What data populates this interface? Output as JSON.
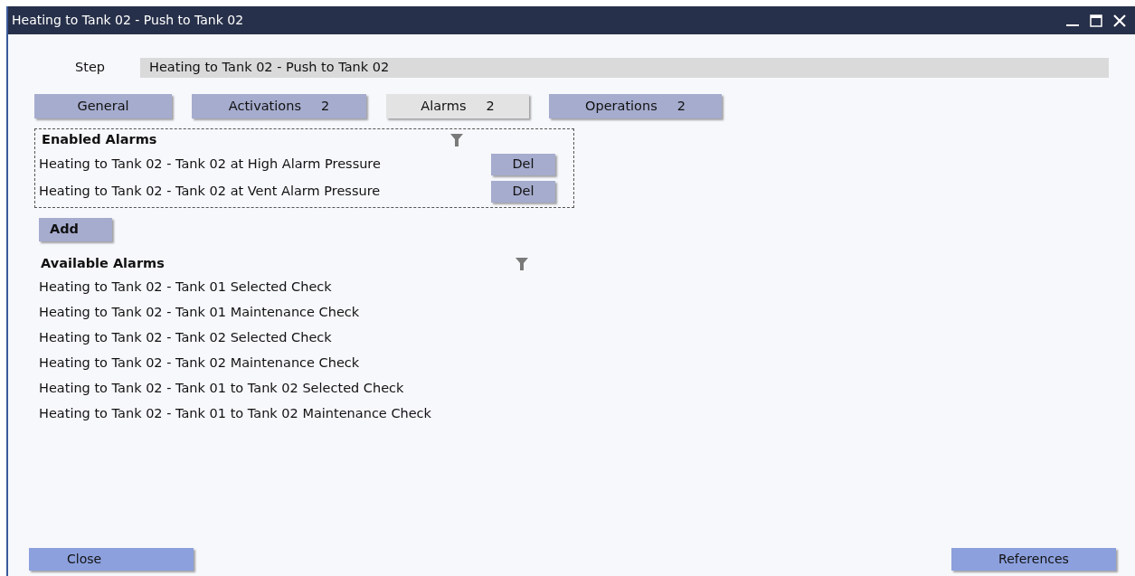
{
  "window": {
    "title": "Heating to Tank 02 - Push to Tank 02"
  },
  "step": {
    "label": "Step",
    "value": "Heating to Tank 02 - Push to Tank 02"
  },
  "tabs": [
    {
      "label": "General",
      "selected": false
    },
    {
      "label": "Activations",
      "count": "2",
      "selected": false
    },
    {
      "label": "Alarms",
      "count": "2",
      "selected": true
    },
    {
      "label": "Operations",
      "count": "2",
      "selected": false
    }
  ],
  "enabled_alarms": {
    "title": "Enabled Alarms",
    "items": [
      {
        "name": "Heating to Tank 02 - Tank 02 at High Alarm Pressure",
        "button": "Del"
      },
      {
        "name": "Heating to Tank 02 - Tank 02 at Vent Alarm Pressure",
        "button": "Del"
      }
    ]
  },
  "add_button": "Add",
  "available_alarms": {
    "title": "Available Alarms",
    "items": [
      "Heating to Tank 02 - Tank 01 Selected Check",
      "Heating to Tank 02 - Tank 01 Maintenance Check",
      "Heating to Tank 02 - Tank 02 Selected Check",
      "Heating to Tank 02 - Tank 02 Maintenance Check",
      "Heating to Tank 02 - Tank 01 to Tank 02 Selected Check",
      "Heating to Tank 02 - Tank 01 to Tank 02 Maintenance Check"
    ]
  },
  "footer": {
    "close": "Close",
    "references": "References"
  }
}
